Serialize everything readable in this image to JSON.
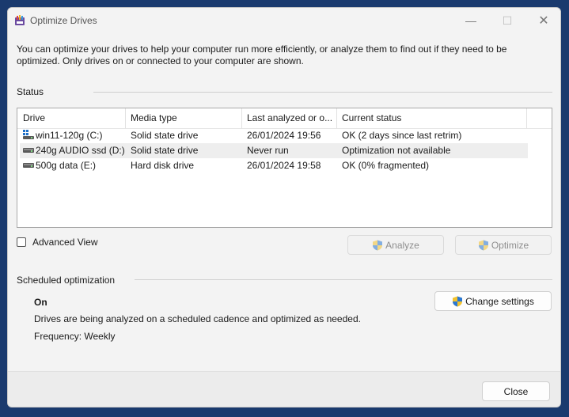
{
  "window": {
    "title": "Optimize Drives",
    "controls": {
      "minimize": "—",
      "maximize": "☐",
      "close": "✕"
    }
  },
  "intro": {
    "line1": "You can optimize your drives to help your computer run more efficiently, or analyze them to find out if they need to be",
    "line2": "optimized. Only drives on or connected to your computer are shown."
  },
  "status": {
    "label": "Status",
    "columns": [
      "Drive",
      "Media type",
      "Last analyzed or o...",
      "Current status"
    ],
    "rows": [
      {
        "icon": "windows-drive-icon",
        "drive": "win11-120g (C:)",
        "media": "Solid state drive",
        "last": "26/01/2024 19:56",
        "status": "OK (2 days since last retrim)"
      },
      {
        "icon": "drive-icon",
        "drive": "240g AUDIO ssd (D:)",
        "media": "Solid state drive",
        "last": "Never run",
        "status": "Optimization not available"
      },
      {
        "icon": "drive-icon",
        "drive": "500g data (E:)",
        "media": "Hard disk drive",
        "last": "26/01/2024 19:58",
        "status": "OK (0% fragmented)"
      }
    ],
    "selected_row": 1
  },
  "advanced_view": {
    "label": "Advanced View",
    "checked": false
  },
  "buttons": {
    "analyze": "Analyze",
    "optimize": "Optimize",
    "change_settings": "Change settings",
    "close": "Close"
  },
  "scheduled": {
    "label": "Scheduled optimization",
    "state": "On",
    "description": "Drives are being analyzed on a scheduled cadence and optimized as needed.",
    "frequency": "Frequency: Weekly"
  },
  "colors": {
    "accent": "#0078d4",
    "background": "#1a3a6e",
    "window": "#f3f3f3",
    "selected_row": "#eeeeee"
  }
}
